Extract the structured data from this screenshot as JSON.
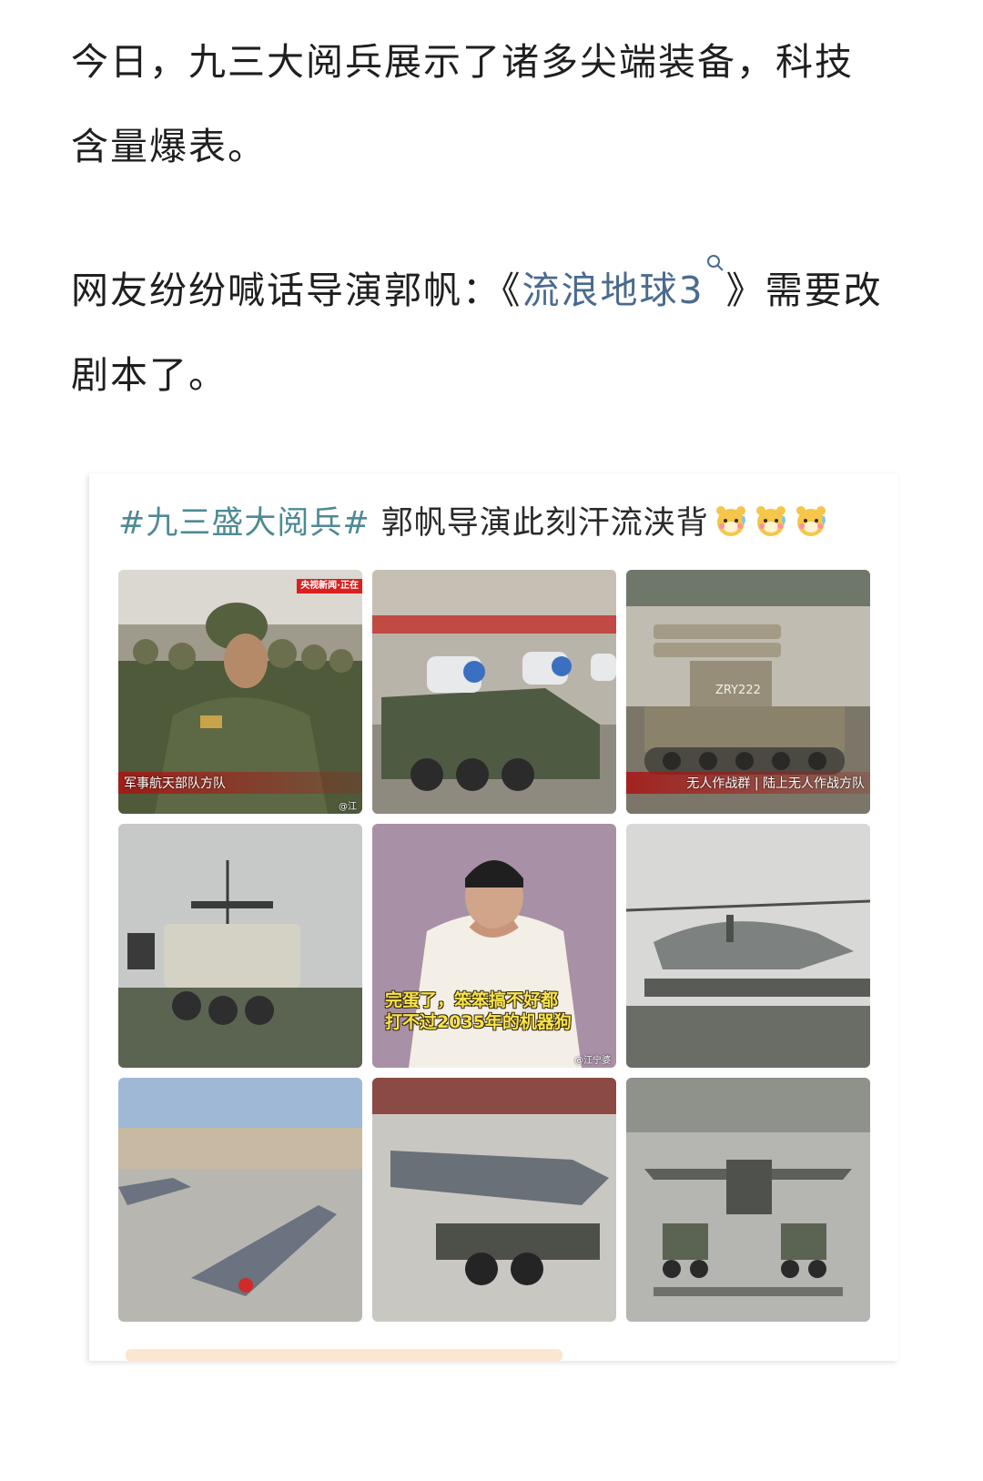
{
  "article": {
    "paragraph1": "今日，九三大阅兵展示了诸多尖端装备，科技含量爆表。",
    "paragraph2_before": "网友纷纷喊话导演郭帆：《",
    "paragraph2_link": "流浪地球3",
    "paragraph2_after": "》需要改剧本了。"
  },
  "colors": {
    "link": "#4a6b8e",
    "hashtag": "#4e8a94",
    "meme_text": "#f7e44a",
    "news_red": "#d92020"
  },
  "embedded_post": {
    "hashtag": "#九三盛大阅兵#",
    "caption": " 郭帆导演此刻汗流浃背",
    "emoji": [
      "sweating-hamster-emoji",
      "sweating-hamster-emoji",
      "sweating-hamster-emoji"
    ],
    "tiles": [
      {
        "id": "soldiers",
        "caption": "军事航天部队方队",
        "logo": "央视新闻·正在",
        "watermark": "@江"
      },
      {
        "id": "vehicles",
        "caption": "",
        "logo": "",
        "watermark": ""
      },
      {
        "id": "tank",
        "caption": "无人作战群 | 陆上无人作战方队",
        "logo": "",
        "watermark": "",
        "hull_label": "ZRY222"
      },
      {
        "id": "robot-vehicle",
        "caption": "",
        "logo": "",
        "watermark": ""
      },
      {
        "id": "director",
        "caption": "",
        "meme_line1": "完蛋了，笨笨搞不好都",
        "meme_line2": "打不过2035年的机器狗",
        "watermark": "@江宁婆"
      },
      {
        "id": "helicopter",
        "caption": "",
        "logo": "",
        "watermark": ""
      },
      {
        "id": "drone-jet",
        "caption": "",
        "logo": "",
        "watermark": ""
      },
      {
        "id": "stealth-drone",
        "caption": "",
        "logo": "",
        "watermark": ""
      },
      {
        "id": "uav-formation",
        "caption": "",
        "logo": "",
        "watermark": ""
      }
    ]
  }
}
